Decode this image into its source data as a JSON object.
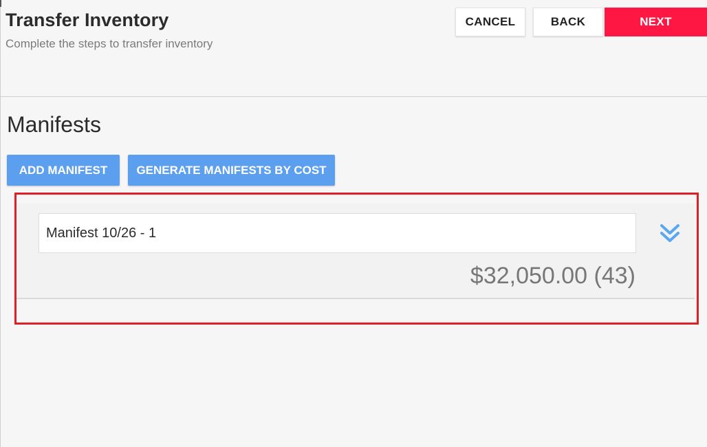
{
  "header": {
    "title": "Transfer Inventory",
    "subtitle": "Complete the steps to transfer inventory"
  },
  "actions": {
    "cancel_label": "CANCEL",
    "back_label": "BACK",
    "next_label": "NEXT"
  },
  "manifests": {
    "section_title": "Manifests",
    "add_label": "ADD MANIFEST",
    "generate_label": "GENERATE MANIFESTS BY COST",
    "items": [
      {
        "name": "Manifest 10/26 - 1",
        "total": "$32,050.00 (43)",
        "expand_icon": "double-chevron-down-icon"
      }
    ]
  },
  "colors": {
    "background": "#f6f6f6",
    "primary_red": "#ff1744",
    "button_blue": "#5c9fee",
    "icon_blue": "#5aa7f0",
    "highlight_red": "#dd1f26"
  }
}
